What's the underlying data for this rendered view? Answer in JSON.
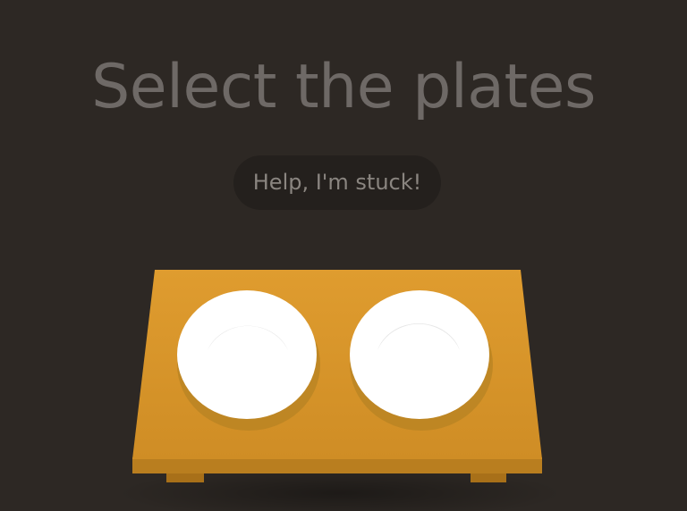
{
  "level": {
    "instruction": "Select the plates",
    "help_label": "Help, I'm stuck!"
  },
  "table": {
    "items": [
      {
        "type": "plate"
      },
      {
        "type": "plate"
      }
    ]
  },
  "colors": {
    "background": "#2d2824",
    "title_text": "#6e6966",
    "help_bg": "#24201d",
    "help_text": "#8a8580",
    "table_top": "#de9b2e",
    "table_top_bottom": "#c98a22",
    "table_edge": "#b97e1f",
    "table_leg": "#a87019",
    "plate": "#ffffff",
    "plate_inner": "#ececec",
    "plate_shadow": "#b78323"
  }
}
